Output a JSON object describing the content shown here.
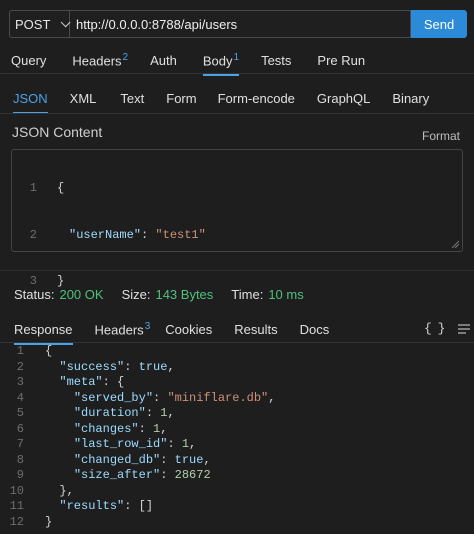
{
  "request": {
    "method": "POST",
    "url": "http://0.0.0.0:8788/api/users",
    "send_label": "Send"
  },
  "request_tabs": [
    {
      "label": "Query",
      "badge": ""
    },
    {
      "label": "Headers",
      "badge": "2"
    },
    {
      "label": "Auth",
      "badge": ""
    },
    {
      "label": "Body",
      "badge": "1",
      "active": true
    },
    {
      "label": "Tests",
      "badge": ""
    },
    {
      "label": "Pre Run",
      "badge": ""
    }
  ],
  "body_types": [
    "JSON",
    "XML",
    "Text",
    "Form",
    "Form-encode",
    "GraphQL",
    "Binary"
  ],
  "body_type_active": "JSON",
  "json_content_label": "JSON Content",
  "format_label": "Format",
  "request_body_lines": [
    "1",
    "2",
    "3"
  ],
  "request_body": {
    "open": "{",
    "key": "\"userName\"",
    "colon": ": ",
    "value": "\"test1\"",
    "close": "}"
  },
  "status": {
    "status_label": "Status:",
    "status_value": "200 OK",
    "size_label": "Size:",
    "size_value": "143 Bytes",
    "time_label": "Time:",
    "time_value": "10 ms"
  },
  "response_tabs": [
    {
      "label": "Response",
      "badge": "",
      "active": true
    },
    {
      "label": "Headers",
      "badge": "3"
    },
    {
      "label": "Cookies",
      "badge": ""
    },
    {
      "label": "Results",
      "badge": ""
    },
    {
      "label": "Docs",
      "badge": ""
    }
  ],
  "braces_label": "{ }",
  "response_lines": [
    {
      "n": "1",
      "html": "<span class='p'>{</span>"
    },
    {
      "n": "2",
      "html": "  <span class='key'>\"success\"</span><span class='p'>: </span><span class='kw'>true</span><span class='p'>,</span>"
    },
    {
      "n": "3",
      "html": "  <span class='key'>\"meta\"</span><span class='p'>: {</span>"
    },
    {
      "n": "4",
      "html": "    <span class='key'>\"served_by\"</span><span class='p'>: </span><span class='str'>\"miniflare.db\"</span><span class='p'>,</span>"
    },
    {
      "n": "5",
      "html": "    <span class='key'>\"duration\"</span><span class='p'>: </span><span class='num'>1</span><span class='p'>,</span>"
    },
    {
      "n": "6",
      "html": "    <span class='key'>\"changes\"</span><span class='p'>: </span><span class='num'>1</span><span class='p'>,</span>"
    },
    {
      "n": "7",
      "html": "    <span class='key'>\"last_row_id\"</span><span class='p'>: </span><span class='num'>1</span><span class='p'>,</span>"
    },
    {
      "n": "8",
      "html": "    <span class='key'>\"changed_db\"</span><span class='p'>: </span><span class='kw'>true</span><span class='p'>,</span>"
    },
    {
      "n": "9",
      "html": "    <span class='key'>\"size_after\"</span><span class='p'>: </span><span class='num'>28672</span>"
    },
    {
      "n": "10",
      "html": "  <span class='p'>},</span>"
    },
    {
      "n": "11",
      "html": "  <span class='key'>\"results\"</span><span class='p'>: []</span>"
    },
    {
      "n": "12",
      "html": "<span class='p'>}</span>"
    }
  ]
}
